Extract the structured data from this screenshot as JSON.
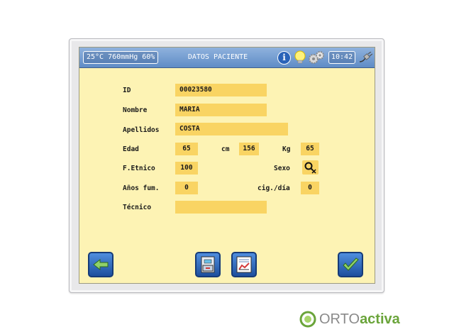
{
  "header": {
    "environment": "25°C 760mmHg 60%",
    "title": "DATOS PACIENTE",
    "info_icon": "i",
    "clock": "10:42"
  },
  "form": {
    "id_label": "ID",
    "id_value": "00023580",
    "nombre_label": "Nombre",
    "nombre_value": "MARIA",
    "apellidos_label": "Apellidos",
    "apellidos_value": "COSTA",
    "edad_label": "Edad",
    "edad_value": "65",
    "cm_label": "cm",
    "cm_value": "156",
    "kg_label": "Kg",
    "kg_value": "65",
    "fetnico_label": "F.Etnico",
    "fetnico_value": "100",
    "sexo_label": "Sexo",
    "anos_label": "Años fum.",
    "anos_value": "0",
    "cig_label": "cig./día",
    "cig_value": "0",
    "tecnico_label": "Técnico",
    "tecnico_value": ""
  },
  "icons": {
    "back": "arrow-left-icon",
    "database": "archive-drawer-icon",
    "report": "report-chart-icon",
    "confirm": "checkmark-icon",
    "sex_select": "gender-icon"
  },
  "logo": {
    "part1": "ORTO",
    "part2": "activa"
  },
  "colors": {
    "screen_bg": "#fdf3b4",
    "field_bg": "#f9d463",
    "topbar": "#6f9ad0",
    "button": "#2a63b8",
    "logo_green": "#6aa43a"
  }
}
